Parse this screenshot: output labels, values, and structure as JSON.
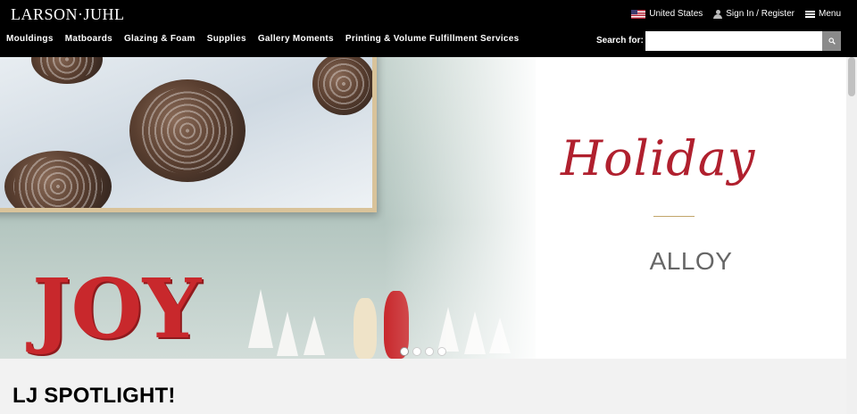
{
  "header": {
    "logo_text": "LARSON·JUHL",
    "utility": {
      "country": "United States",
      "signin": "Sign In / Register",
      "menu": "Menu"
    },
    "nav": [
      "Mouldings",
      "Matboards",
      "Glazing & Foam",
      "Supplies",
      "Gallery Moments",
      "Printing & Volume Fulfillment Services"
    ],
    "search": {
      "label": "Search for:",
      "value": ""
    }
  },
  "hero": {
    "title": "Holiday",
    "subtitle": "ALLOY",
    "photo_text": "JOY",
    "slides": 4,
    "active_slide": 1
  },
  "spotlight": {
    "heading": "LJ SPOTLIGHT!"
  },
  "colors": {
    "header_bg": "#000000",
    "accent_red": "#b0202e",
    "divider_gold": "#c2a56a"
  }
}
